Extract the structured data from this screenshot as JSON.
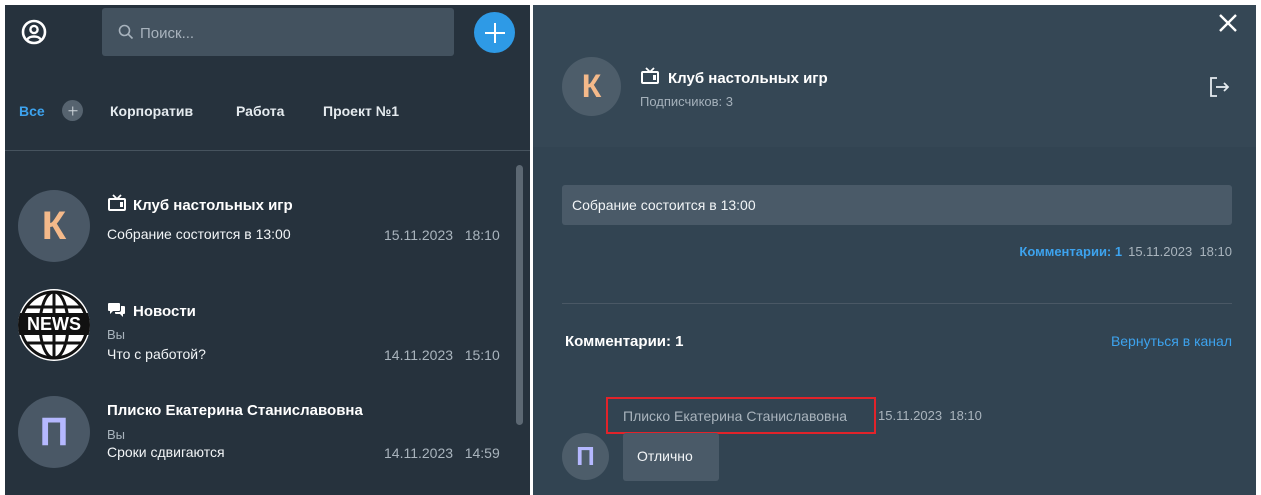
{
  "search": {
    "placeholder": "Поиск..."
  },
  "tabs": [
    {
      "label": "Все"
    },
    {
      "label": "Корпоратив"
    },
    {
      "label": "Работа"
    },
    {
      "label": "Проект №1"
    }
  ],
  "chats": [
    {
      "avatar_letter": "К",
      "title": "Клуб настольных игр",
      "icon": "tv-icon",
      "sender": "",
      "last_message": "Собрание состоится в 13:00",
      "date": "15.11.2023",
      "time": "18:10"
    },
    {
      "avatar_letter": "NEWS",
      "title": "Новости",
      "icon": "chat-bubbles-icon",
      "sender": "Вы",
      "last_message": "Что с работой?",
      "date": "14.11.2023",
      "time": "15:10"
    },
    {
      "avatar_letter": "П",
      "title": "Плиско Екатерина Станиславовна",
      "icon": "",
      "sender": "Вы",
      "last_message": "Сроки сдвигаются",
      "date": "14.11.2023",
      "time": "14:59"
    }
  ],
  "channel": {
    "avatar_letter": "К",
    "title": "Клуб настольных игр",
    "subscribers": "Подписчиков: 3"
  },
  "post": {
    "text": "Собрание состоится в 13:00",
    "comments_link": "Комментарии: 1",
    "date": "15.11.2023",
    "time": "18:10"
  },
  "comments": {
    "title": "Комментарии: 1",
    "back_link": "Вернуться в канал",
    "items": [
      {
        "avatar_letter": "П",
        "author": "Плиско Екатерина Станиславовна",
        "date": "15.11.2023",
        "time": "18:10",
        "text": "Отлично"
      }
    ]
  },
  "colors": {
    "accent": "#3da3ee",
    "left_panel": "#26323d",
    "right_panel": "#324452",
    "highlight": "#e2232a"
  }
}
